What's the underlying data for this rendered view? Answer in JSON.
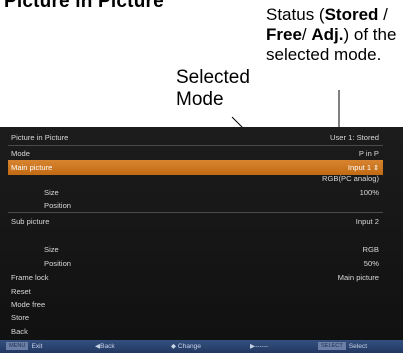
{
  "annotations": {
    "heading": "Picture in Picture",
    "selected_mode": "Selected Mode",
    "status_prefix": "Status (",
    "status_stored": "Stored",
    "status_sep1": " / ",
    "status_free": "Free",
    "status_sep2": "/ ",
    "status_adj": "Adj.",
    "status_suffix": ") of the selected mode."
  },
  "menu": {
    "title": "Picture in Picture",
    "title_value": "User 1: Stored",
    "rows": [
      {
        "label": "Mode",
        "value": "P in P"
      },
      {
        "label": "Main picture",
        "value": "Input 1"
      },
      {
        "label": "",
        "value": "RGB(PC analog)"
      },
      {
        "label": "Size",
        "value": "100%"
      },
      {
        "label": "Position",
        "value": ""
      },
      {
        "label": "Sub picture",
        "value": "Input 2"
      },
      {
        "label": "",
        "value": ""
      },
      {
        "label": "Size",
        "value": "RGB"
      },
      {
        "label": "Position",
        "value": "50%"
      },
      {
        "label": "Frame lock",
        "value": "Main picture"
      },
      {
        "label": "Reset",
        "value": ""
      },
      {
        "label": "Mode free",
        "value": ""
      },
      {
        "label": "Store",
        "value": ""
      },
      {
        "label": "Back",
        "value": ""
      }
    ]
  },
  "footer": {
    "exit_key": "MENU",
    "exit_label": "Exit",
    "back_label": "◀Back",
    "change_label": "◆ Change",
    "next_label": "▶------",
    "select_key": "SELECT",
    "select_label": "Select"
  },
  "colors": {
    "highlight": "#c8731e",
    "screen_bg": "#141414",
    "footer_bg": "#2a3f6a"
  }
}
